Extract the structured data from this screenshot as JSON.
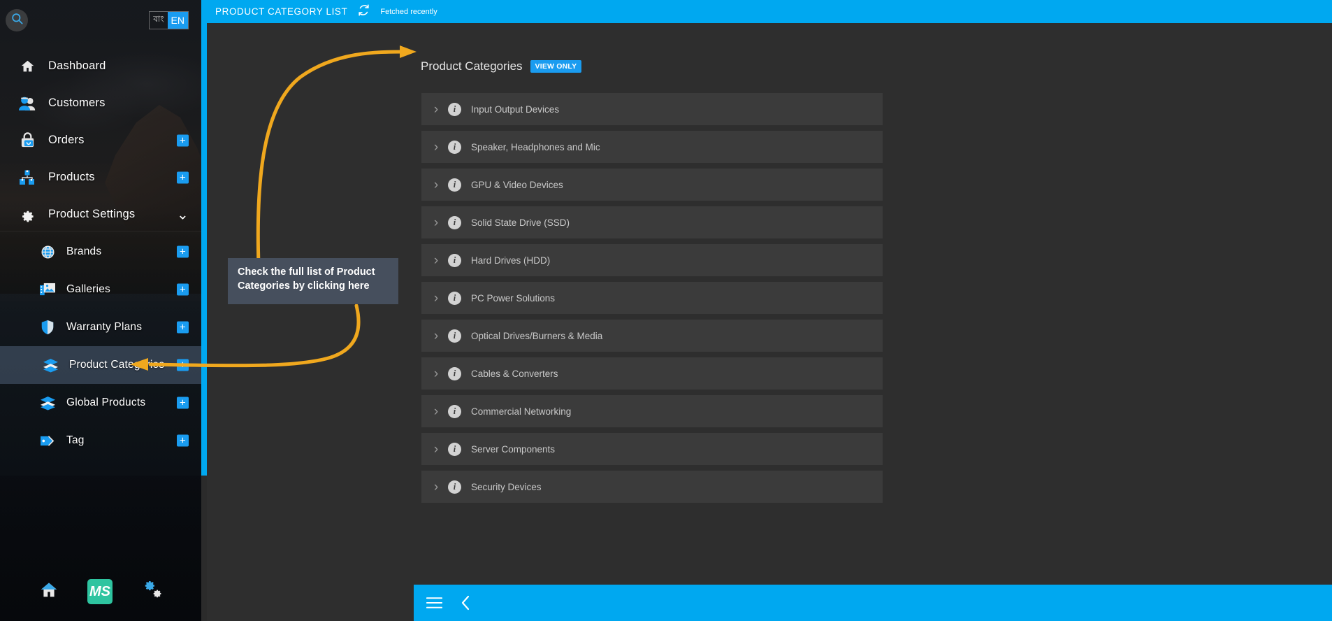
{
  "sidebar": {
    "search_icon": "search-icon",
    "language": {
      "bn_label": "বাং",
      "en_label": "EN",
      "active": "EN"
    },
    "items": [
      {
        "label": "Dashboard",
        "icon": "home-icon",
        "badge": "",
        "level": 0,
        "active": false,
        "chevron": ""
      },
      {
        "label": "Customers",
        "icon": "users-icon",
        "badge": "",
        "level": 0,
        "active": false,
        "chevron": ""
      },
      {
        "label": "Orders",
        "icon": "shopping-bag-icon",
        "badge": "+",
        "level": 0,
        "active": false,
        "chevron": ""
      },
      {
        "label": "Products",
        "icon": "boxes-icon",
        "badge": "+",
        "level": 0,
        "active": false,
        "chevron": ""
      },
      {
        "label": "Product Settings",
        "icon": "gear-icon",
        "badge": "",
        "level": 0,
        "active": false,
        "chevron": "⌄"
      },
      {
        "label": "Brands",
        "icon": "globe-icon",
        "badge": "+",
        "level": 1,
        "active": false,
        "chevron": ""
      },
      {
        "label": "Galleries",
        "icon": "image-gallery-icon",
        "badge": "+",
        "level": 1,
        "active": false,
        "chevron": ""
      },
      {
        "label": "Warranty Plans",
        "icon": "shield-icon",
        "badge": "+",
        "level": 1,
        "active": false,
        "chevron": ""
      },
      {
        "label": "Product Categories",
        "icon": "layers-icon",
        "badge": "+",
        "level": 1,
        "active": true,
        "chevron": ""
      },
      {
        "label": "Global Products",
        "icon": "layers-icon",
        "badge": "+",
        "level": 1,
        "active": false,
        "chevron": ""
      },
      {
        "label": "Tag",
        "icon": "tag-icon",
        "badge": "+",
        "level": 1,
        "active": false,
        "chevron": ""
      }
    ],
    "tools": [
      {
        "name": "home-button",
        "icon": "home-icon"
      },
      {
        "name": "ms-logo-button",
        "icon": "ms-logo",
        "label": "MS"
      },
      {
        "name": "settings-button",
        "icon": "gears-icon"
      }
    ]
  },
  "topbar": {
    "title": "PRODUCT CATEGORY LIST",
    "refresh_icon": "refresh-icon",
    "status": "Fetched recently"
  },
  "page": {
    "title": "Product Categories",
    "badge": "VIEW ONLY"
  },
  "categories": [
    {
      "label": "Input Output Devices",
      "chevron": "›",
      "info": "i"
    },
    {
      "label": "Speaker, Headphones and Mic",
      "chevron": "›",
      "info": "i"
    },
    {
      "label": "GPU & Video Devices",
      "chevron": "›",
      "info": "i"
    },
    {
      "label": "Solid State Drive (SSD)",
      "chevron": "›",
      "info": "i"
    },
    {
      "label": "Hard Drives (HDD)",
      "chevron": "›",
      "info": "i"
    },
    {
      "label": "PC Power Solutions",
      "chevron": "›",
      "info": "i"
    },
    {
      "label": "Optical Drives/Burners & Media",
      "chevron": "›",
      "info": "i"
    },
    {
      "label": "Cables & Converters",
      "chevron": "›",
      "info": "i"
    },
    {
      "label": "Commercial Networking",
      "chevron": "›",
      "info": "i"
    },
    {
      "label": "Server Components",
      "chevron": "›",
      "info": "i"
    },
    {
      "label": "Security Devices",
      "chevron": "›",
      "info": "i"
    }
  ],
  "callout": {
    "text": "Check the full list of Product Categories by clicking here",
    "color": "#f0a81e",
    "box_color": "#464f5d"
  },
  "bottombar": {
    "menu_icon": "hamburger-menu-icon",
    "back_icon": "chevron-left-icon"
  },
  "colors": {
    "accent_blue": "#00a8f0",
    "badge_blue": "#1a9cf0",
    "annotation_orange": "#f0a81e",
    "panel_dark": "#2e2e2e",
    "row_dark": "#3b3b3b"
  }
}
